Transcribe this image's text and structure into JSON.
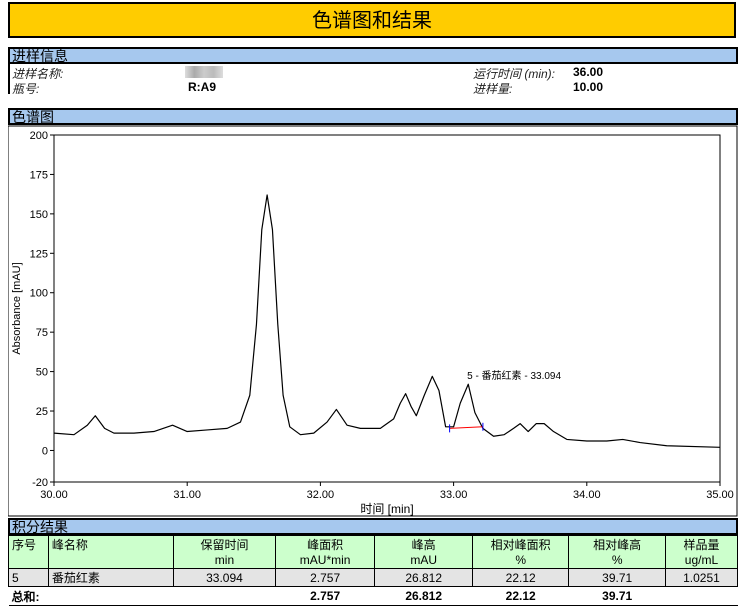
{
  "title": "色谱图和结果",
  "sample_info": {
    "header": "进样信息",
    "name_label": "进样名称:",
    "vial_label": "瓶号:",
    "vial": "R:A9",
    "runtime_label": "运行时间 (min):",
    "runtime": "36.00",
    "volume_label": "进样量:",
    "volume": "10.00"
  },
  "chromatogram_header": "色谱图",
  "chart_data": {
    "type": "line",
    "xlabel": "时间 [min]",
    "ylabel": "Absorbance [mAU]",
    "xlim": [
      30,
      35
    ],
    "ylim": [
      -20,
      200
    ],
    "xticks": [
      "30.00",
      "31.00",
      "32.00",
      "33.00",
      "34.00",
      "35.00"
    ],
    "yticks": [
      "-20",
      "0",
      "25",
      "50",
      "75",
      "100",
      "125",
      "150",
      "175",
      "200"
    ],
    "grid": false,
    "series": [
      {
        "x": [
          30.0,
          30.15,
          30.25,
          30.31,
          30.38,
          30.45,
          30.6,
          30.75,
          30.89,
          31.0,
          31.15,
          31.3,
          31.4,
          31.47,
          31.52,
          31.56,
          31.6,
          31.64,
          31.68,
          31.72,
          31.77,
          31.85,
          31.95,
          32.05,
          32.12,
          32.2,
          32.3,
          32.45,
          32.55,
          32.6,
          32.64,
          32.68,
          32.72,
          32.78,
          32.84,
          32.89,
          32.94,
          33.0,
          33.05,
          33.11,
          33.16,
          33.22,
          33.3,
          33.38,
          33.45,
          33.5,
          33.56,
          33.62,
          33.68,
          33.75,
          33.85,
          34.0,
          34.15,
          34.27,
          34.4,
          34.6,
          35.0
        ],
        "y": [
          11,
          10,
          16,
          22,
          14,
          11,
          11,
          12,
          16,
          12,
          13,
          14,
          18,
          35,
          80,
          140,
          162,
          140,
          80,
          35,
          15,
          10,
          11,
          18,
          26,
          16,
          14,
          14,
          20,
          30,
          36,
          28,
          22,
          35,
          47,
          38,
          15,
          15,
          30,
          42,
          24,
          14,
          9,
          10,
          14,
          17,
          12,
          17,
          17,
          12,
          7,
          6,
          6,
          7,
          5,
          3,
          2
        ]
      }
    ],
    "annotation": {
      "label": "5 - 番茄红素 - 33.094",
      "x": 33.094,
      "y": 42,
      "baseline": [
        [
          32.97,
          14
        ],
        [
          33.22,
          15
        ]
      ]
    }
  },
  "results": {
    "header": "积分结果",
    "columns": [
      [
        "序号",
        ""
      ],
      [
        "峰名称",
        ""
      ],
      [
        "保留时间",
        "min"
      ],
      [
        "峰面积",
        "mAU*min"
      ],
      [
        "峰高",
        "mAU"
      ],
      [
        "相对峰面积",
        "%"
      ],
      [
        "相对峰高",
        "%"
      ],
      [
        "样品量",
        "ug/mL"
      ]
    ],
    "rows": [
      [
        "5",
        "番茄红素",
        "33.094",
        "2.757",
        "26.812",
        "22.12",
        "39.71",
        "1.0251"
      ]
    ],
    "total": [
      "总和:",
      "",
      "",
      "2.757",
      "26.812",
      "22.12",
      "39.71",
      ""
    ]
  },
  "colors": {
    "title_bg": "#ffcc00",
    "section_bg": "#a6c8ee",
    "header_bg": "#ccffcc",
    "trace": "#000000",
    "baseline": "#ff0000",
    "marker": "#0000ff"
  }
}
